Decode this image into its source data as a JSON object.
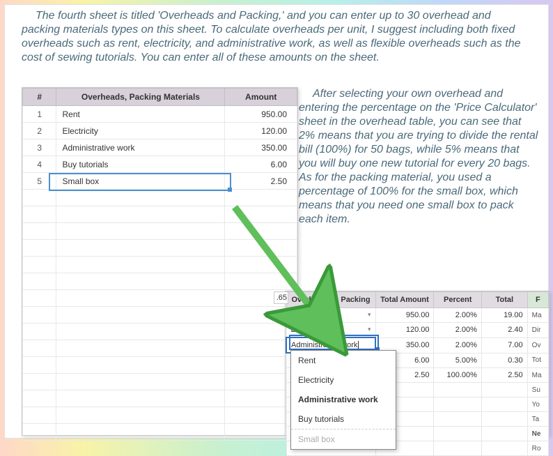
{
  "intro_para": "The fourth sheet is titled 'Overheads and Packing,' and you can enter up to 30 overhead and packing materials types on this sheet. To calculate overheads per unit, I suggest including both fixed overheads such as rent, electricity, and administrative work, as well as flexible overheads such as the cost of sewing tutorials. You can enter all of these amounts on the sheet.",
  "side_para": "After selecting your own overhead and entering the percentage on the 'Price Calculator' sheet in the overhead table, you can see that 2% means that you are trying to divide the rental bill (100%) for 50 bags, while 5% means that you will buy one new tutorial for every 20 bags. As for the packing material, you used a percentage of 100% for the small box, which means that you need one small box to pack each item.",
  "sheet1": {
    "headers": {
      "num": "#",
      "name": "Overheads, Packing Materials",
      "amount": "Amount"
    },
    "rows": [
      {
        "n": "1",
        "name": "Rent",
        "amount": "950.00"
      },
      {
        "n": "2",
        "name": "Electricity",
        "amount": "120.00"
      },
      {
        "n": "3",
        "name": "Administrative work",
        "amount": "350.00"
      },
      {
        "n": "4",
        "name": "Buy tutorials",
        "amount": "6.00"
      },
      {
        "n": "5",
        "name": "Small box",
        "amount": "2.50"
      }
    ]
  },
  "sheet2": {
    "frag_value": ".65",
    "headers": {
      "name": "Overheads & Packing",
      "total_amount": "Total Amount",
      "percent": "Percent",
      "total": "Total",
      "side": "F"
    },
    "rows": [
      {
        "name": "Rent",
        "amt": "950.00",
        "pct": "2.00%",
        "tot": "19.00"
      },
      {
        "name": "Electricity",
        "amt": "120.00",
        "pct": "2.00%",
        "tot": "2.40"
      },
      {
        "name": "Administrative work",
        "amt": "350.00",
        "pct": "2.00%",
        "tot": "7.00"
      },
      {
        "name": "",
        "amt": "6.00",
        "pct": "5.00%",
        "tot": "0.30"
      },
      {
        "name": "",
        "amt": "2.50",
        "pct": "100.00%",
        "tot": "2.50"
      }
    ],
    "side_labels": [
      "Ma",
      "Dir",
      "Ov",
      "Tot",
      "Ma",
      "Su",
      "Yo",
      "Ta",
      "Ne",
      "Ro"
    ],
    "dropdown": [
      "Rent",
      "Electricity",
      "Administrative work",
      "Buy tutorials",
      "Small box"
    ]
  }
}
